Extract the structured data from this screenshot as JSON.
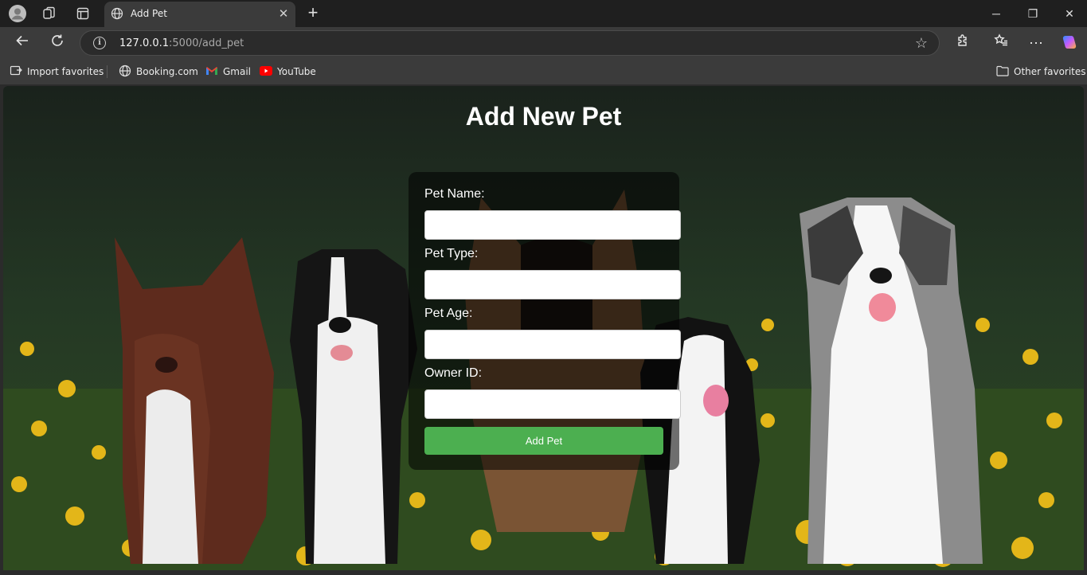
{
  "browser": {
    "tab_title": "Add Pet",
    "url_host": "127.0.0.1",
    "url_path": ":5000/add_pet",
    "bookmarks": [
      {
        "label": "Import favorites",
        "icon": "import-icon"
      },
      {
        "label": "Booking.com",
        "icon": "globe-icon"
      },
      {
        "label": "Gmail",
        "icon": "gmail-icon"
      },
      {
        "label": "YouTube",
        "icon": "youtube-icon"
      }
    ],
    "other_favorites": "Other favorites"
  },
  "page": {
    "title": "Add New Pet",
    "fields": [
      {
        "label": "Pet Name:",
        "value": ""
      },
      {
        "label": "Pet Type:",
        "value": ""
      },
      {
        "label": "Pet Age:",
        "value": ""
      },
      {
        "label": "Owner ID:",
        "value": ""
      }
    ],
    "submit_label": "Add Pet"
  },
  "colors": {
    "accent_button": "#4caf50",
    "card_overlay": "rgba(0,0,0,0.55)"
  }
}
